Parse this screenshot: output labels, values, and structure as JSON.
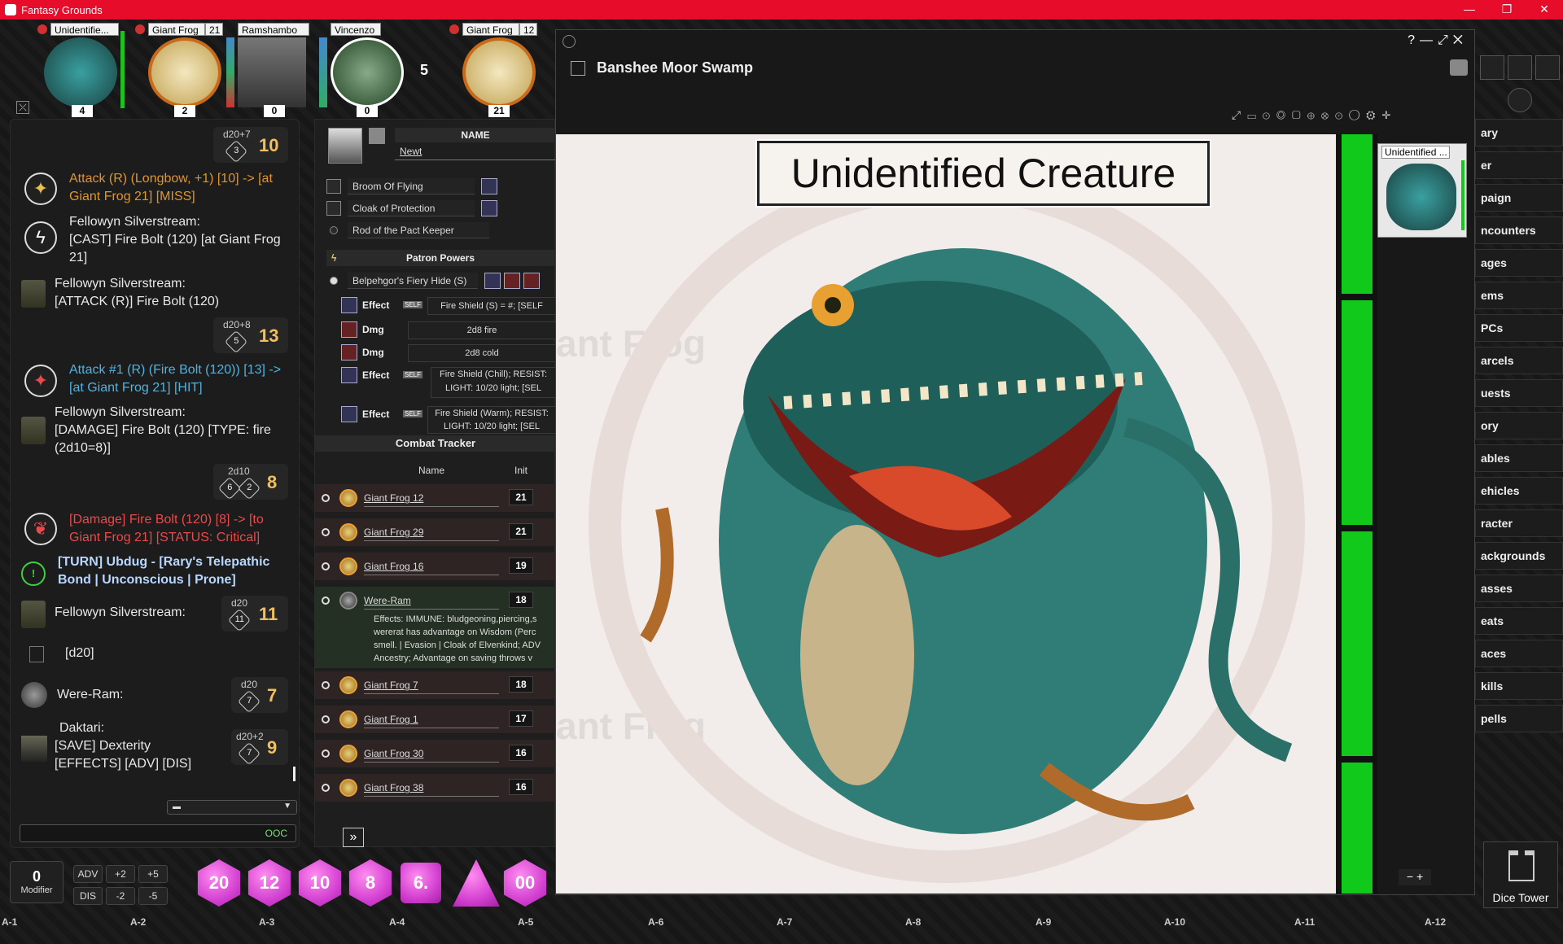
{
  "window": {
    "title": "Fantasy Grounds"
  },
  "portraits": [
    {
      "name": "Unidentifie...",
      "num": "4"
    },
    {
      "name": "Giant Frog",
      "num": "2",
      "badge": "21"
    },
    {
      "name": "Ramshambo",
      "num": "0"
    },
    {
      "name": "Vincenzo",
      "num": "0"
    },
    {
      "name": "Giant Frog",
      "num": "21",
      "badge": "12"
    }
  ],
  "round": "5",
  "chat": {
    "entries": [
      {
        "expr": "d20+7",
        "die": "3",
        "result": "10"
      },
      {
        "text": "Attack (R) (Longbow, +1) [10] -> [at Giant Frog 21] [MISS]"
      },
      {
        "speaker": "Fellowyn Silverstream:",
        "text": "[CAST] Fire Bolt (120) [at Giant Frog 21]"
      },
      {
        "speaker": "Fellowyn Silverstream:",
        "text": "[ATTACK (R)] Fire Bolt (120)"
      },
      {
        "expr": "d20+8",
        "die": "5",
        "result": "13"
      },
      {
        "text": "Attack #1 (R) (Fire Bolt (120)) [13] -> [at Giant Frog 21] [HIT]"
      },
      {
        "speaker": "Fellowyn Silverstream:",
        "text": "[DAMAGE] Fire Bolt (120) [TYPE: fire (2d10=8)]"
      },
      {
        "expr": "2d10",
        "dice": [
          "6",
          "2"
        ],
        "result": "8"
      },
      {
        "text": "[Damage] Fire Bolt (120) [8] -> [to Giant Frog 21] [STATUS: Critical]"
      },
      {
        "text": "[TURN] Ubdug - [Rary's Telepathic Bond | Unconscious | Prone]"
      },
      {
        "speaker": "Fellowyn Silverstream:",
        "expr": "d20",
        "die": "11",
        "result": "11"
      },
      {
        "text": "[d20]"
      },
      {
        "speaker": "Were-Ram:",
        "expr": "d20",
        "die": "7",
        "result": "7"
      },
      {
        "speaker": "Daktari:",
        "text": "[SAVE] Dexterity [EFFECTS] [ADV] [DIS]",
        "expr": "d20+2",
        "die": "7",
        "result": "9"
      }
    ],
    "input_mode": "OOC"
  },
  "modifier": {
    "value": "0",
    "label": "Modifier",
    "buttons": [
      "ADV",
      "+2",
      "+5",
      "DIS",
      "-2",
      "-5"
    ]
  },
  "dice": [
    "20",
    "12",
    "10",
    "8",
    "6.",
    "",
    "00"
  ],
  "character": {
    "name_header": "NAME",
    "name_value": "Newt",
    "items": [
      "Broom Of Flying",
      "Cloak of Protection",
      "Rod of the Pact Keeper"
    ],
    "power_group": "Patron Powers",
    "power": "Belpehgor's Fiery Hide (S)",
    "actions": [
      {
        "kind": "Effect",
        "self": "SELF",
        "value": "Fire Shield (S) = #; [SELF"
      },
      {
        "kind": "Dmg",
        "value": "2d8 fire"
      },
      {
        "kind": "Dmg",
        "value": "2d8 cold"
      },
      {
        "kind": "Effect",
        "self": "SELF",
        "value": "Fire Shield (Chill); RESIST: LIGHT: 10/20 light; [SEL"
      },
      {
        "kind": "Effect",
        "self": "SELF",
        "value": "Fire Shield (Warm); RESIST: LIGHT: 10/20 light; [SEL"
      }
    ]
  },
  "combat_tracker": {
    "title": "Combat Tracker",
    "col_name": "Name",
    "col_init": "Init",
    "rows": [
      {
        "name": "Giant Frog 12",
        "init": "21"
      },
      {
        "name": "Giant Frog 29",
        "init": "21"
      },
      {
        "name": "Giant Frog 16",
        "init": "19"
      },
      {
        "name": "Were-Ram",
        "init": "18",
        "effects": "Effects: IMMUNE: bludgeoning,piercing,s wererat has advantage on Wisdom (Perc smell. | Evasion | Cloak of Elvenkind; ADV Ancestry; Advantage on saving throws v"
      },
      {
        "name": "Giant Frog 7",
        "init": "18"
      },
      {
        "name": "Giant Frog 1",
        "init": "17"
      },
      {
        "name": "Giant Frog 30",
        "init": "16"
      },
      {
        "name": "Giant Frog 38",
        "init": "16"
      }
    ]
  },
  "image_window": {
    "title": "Banshee Moor Swamp",
    "creature_label": "Unidentified Creature",
    "token_label": "Unidentified ...",
    "watermark": "ant Frog"
  },
  "sidebar": [
    "ary",
    "er",
    "paign",
    "ncounters",
    "ages",
    "ems",
    "PCs",
    "arcels",
    "uests",
    "ory",
    "ables",
    "ehicles",
    "racter",
    "ackgrounds",
    "asses",
    "eats",
    "aces",
    "kills",
    "pells"
  ],
  "dice_tower": "Dice Tower",
  "grid": [
    "A-1",
    "A-2",
    "A-3",
    "A-4",
    "A-5",
    "A-6",
    "A-7",
    "A-8",
    "A-9",
    "A-10",
    "A-11",
    "A-12"
  ],
  "colors": {
    "titlebar": "#e60c2a",
    "hp_green": "#11c91b",
    "dice": "#d23fd0"
  }
}
